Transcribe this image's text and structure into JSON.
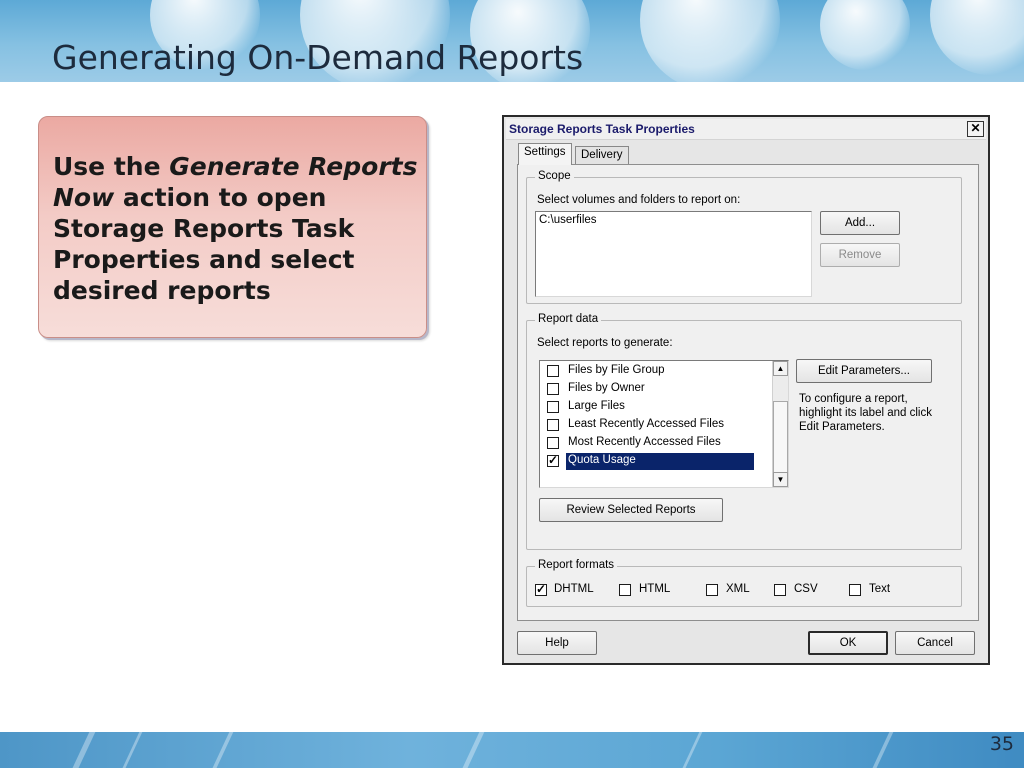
{
  "slide": {
    "title": "Generating On-Demand Reports",
    "page_number": "35"
  },
  "callout": {
    "text_before": "Use the ",
    "text_emphasis": "Generate Reports Now",
    "text_after": " action to open Storage Reports Task Properties and select desired reports"
  },
  "dialog": {
    "title": "Storage Reports Task Properties",
    "close_glyph": "✕",
    "tabs": [
      {
        "label": "Settings",
        "active": true
      },
      {
        "label": "Delivery",
        "active": false
      }
    ],
    "scope": {
      "group_label": "Scope",
      "prompt": "Select volumes and folders to report on:",
      "items": [
        "C:\\userfiles"
      ],
      "add_label": "Add...",
      "remove_label": "Remove"
    },
    "report_data": {
      "group_label": "Report data",
      "prompt": "Select reports to generate:",
      "reports": [
        {
          "label": "Files by File Group",
          "checked": false,
          "selected": false
        },
        {
          "label": "Files by Owner",
          "checked": false,
          "selected": false
        },
        {
          "label": "Large Files",
          "checked": false,
          "selected": false
        },
        {
          "label": "Least Recently Accessed Files",
          "checked": false,
          "selected": false
        },
        {
          "label": "Most Recently Accessed Files",
          "checked": false,
          "selected": false
        },
        {
          "label": "Quota Usage",
          "checked": true,
          "selected": true
        }
      ],
      "edit_parameters_label": "Edit Parameters...",
      "hint": "To configure a report, highlight its label and click Edit Parameters.",
      "review_label": "Review Selected Reports"
    },
    "report_formats": {
      "group_label": "Report formats",
      "formats": [
        {
          "label": "DHTML",
          "checked": true
        },
        {
          "label": "HTML",
          "checked": false
        },
        {
          "label": "XML",
          "checked": false
        },
        {
          "label": "CSV",
          "checked": false
        },
        {
          "label": "Text",
          "checked": false
        }
      ]
    },
    "buttons": {
      "help": "Help",
      "ok": "OK",
      "cancel": "Cancel"
    }
  }
}
